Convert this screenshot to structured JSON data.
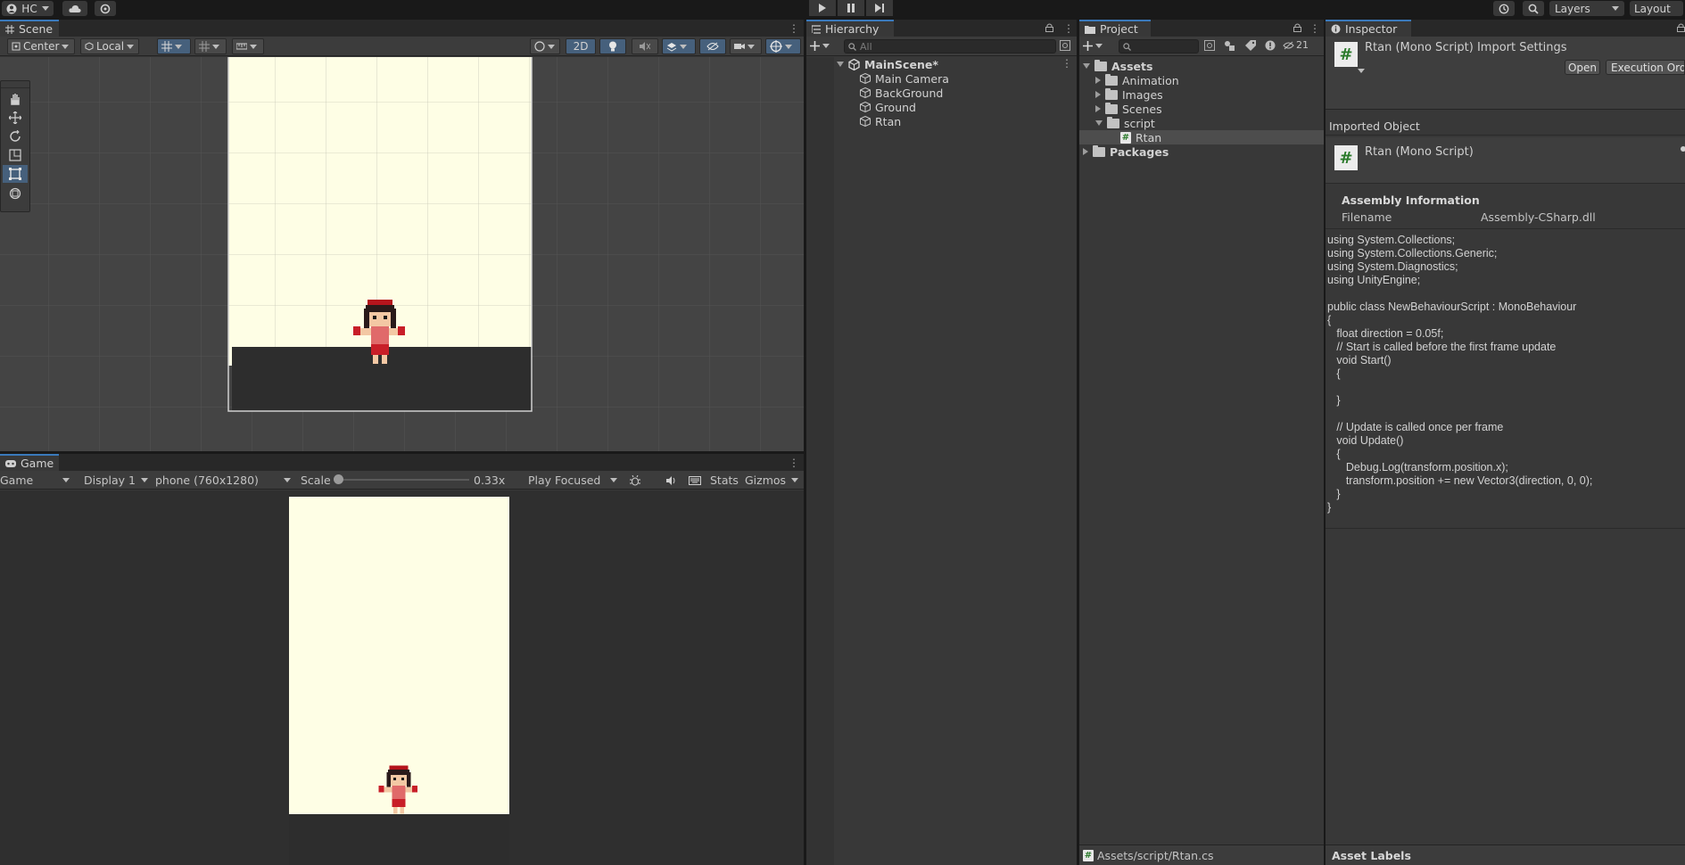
{
  "topbar": {
    "account_label": "HC",
    "layers_label": "Layers",
    "layout_label": "Layout"
  },
  "scene": {
    "tab_label": "Scene",
    "pivot_label": "Center",
    "space_label": "Local",
    "mode_2d_label": "2D"
  },
  "game": {
    "tab_label": "Game",
    "view_label": "Game",
    "display_label": "Display 1",
    "resolution_label": "phone (760x1280)",
    "scale_label": "Scale",
    "scale_value": "0.33x",
    "play_focus_label": "Play Focused",
    "stats_label": "Stats",
    "gizmos_label": "Gizmos"
  },
  "hierarchy": {
    "tab_label": "Hierarchy",
    "search_placeholder": "All",
    "scene_name": "MainScene*",
    "items": [
      "Main Camera",
      "BackGround",
      "Ground",
      "Rtan"
    ]
  },
  "project": {
    "tab_label": "Project",
    "hidden_count": "21",
    "assets_label": "Assets",
    "folders": [
      "Animation",
      "Images",
      "Scenes",
      "script"
    ],
    "script_file": "Rtan",
    "packages_label": "Packages",
    "path": "Assets/script/Rtan.cs"
  },
  "inspector": {
    "tab_label": "Inspector",
    "title": "Rtan (Mono Script) Import Settings",
    "open_label": "Open",
    "exec_order_label": "Execution Orde",
    "imported_object_label": "Imported Object",
    "object_name": "Rtan (Mono Script)",
    "assembly_heading": "Assembly Information",
    "filename_label": "Filename",
    "filename_value": "Assembly-CSharp.dll",
    "code": "using System.Collections;\nusing System.Collections.Generic;\nusing System.Diagnostics;\nusing UnityEngine;\n\npublic class NewBehaviourScript : MonoBehaviour\n{\n   float direction = 0.05f;\n   // Start is called before the first frame update\n   void Start()\n   {\n\n   }\n\n   // Update is called once per frame\n   void Update()\n   {\n      Debug.Log(transform.position.x);\n      transform.position += new Vector3(direction, 0, 0);\n   }\n}",
    "asset_labels": "Asset Labels"
  },
  "colors": {
    "background_cream": "#fefee5",
    "ground_dark": "#2d2d2d",
    "accent_blue": "#3a79bb",
    "panel_bg": "#383838"
  }
}
